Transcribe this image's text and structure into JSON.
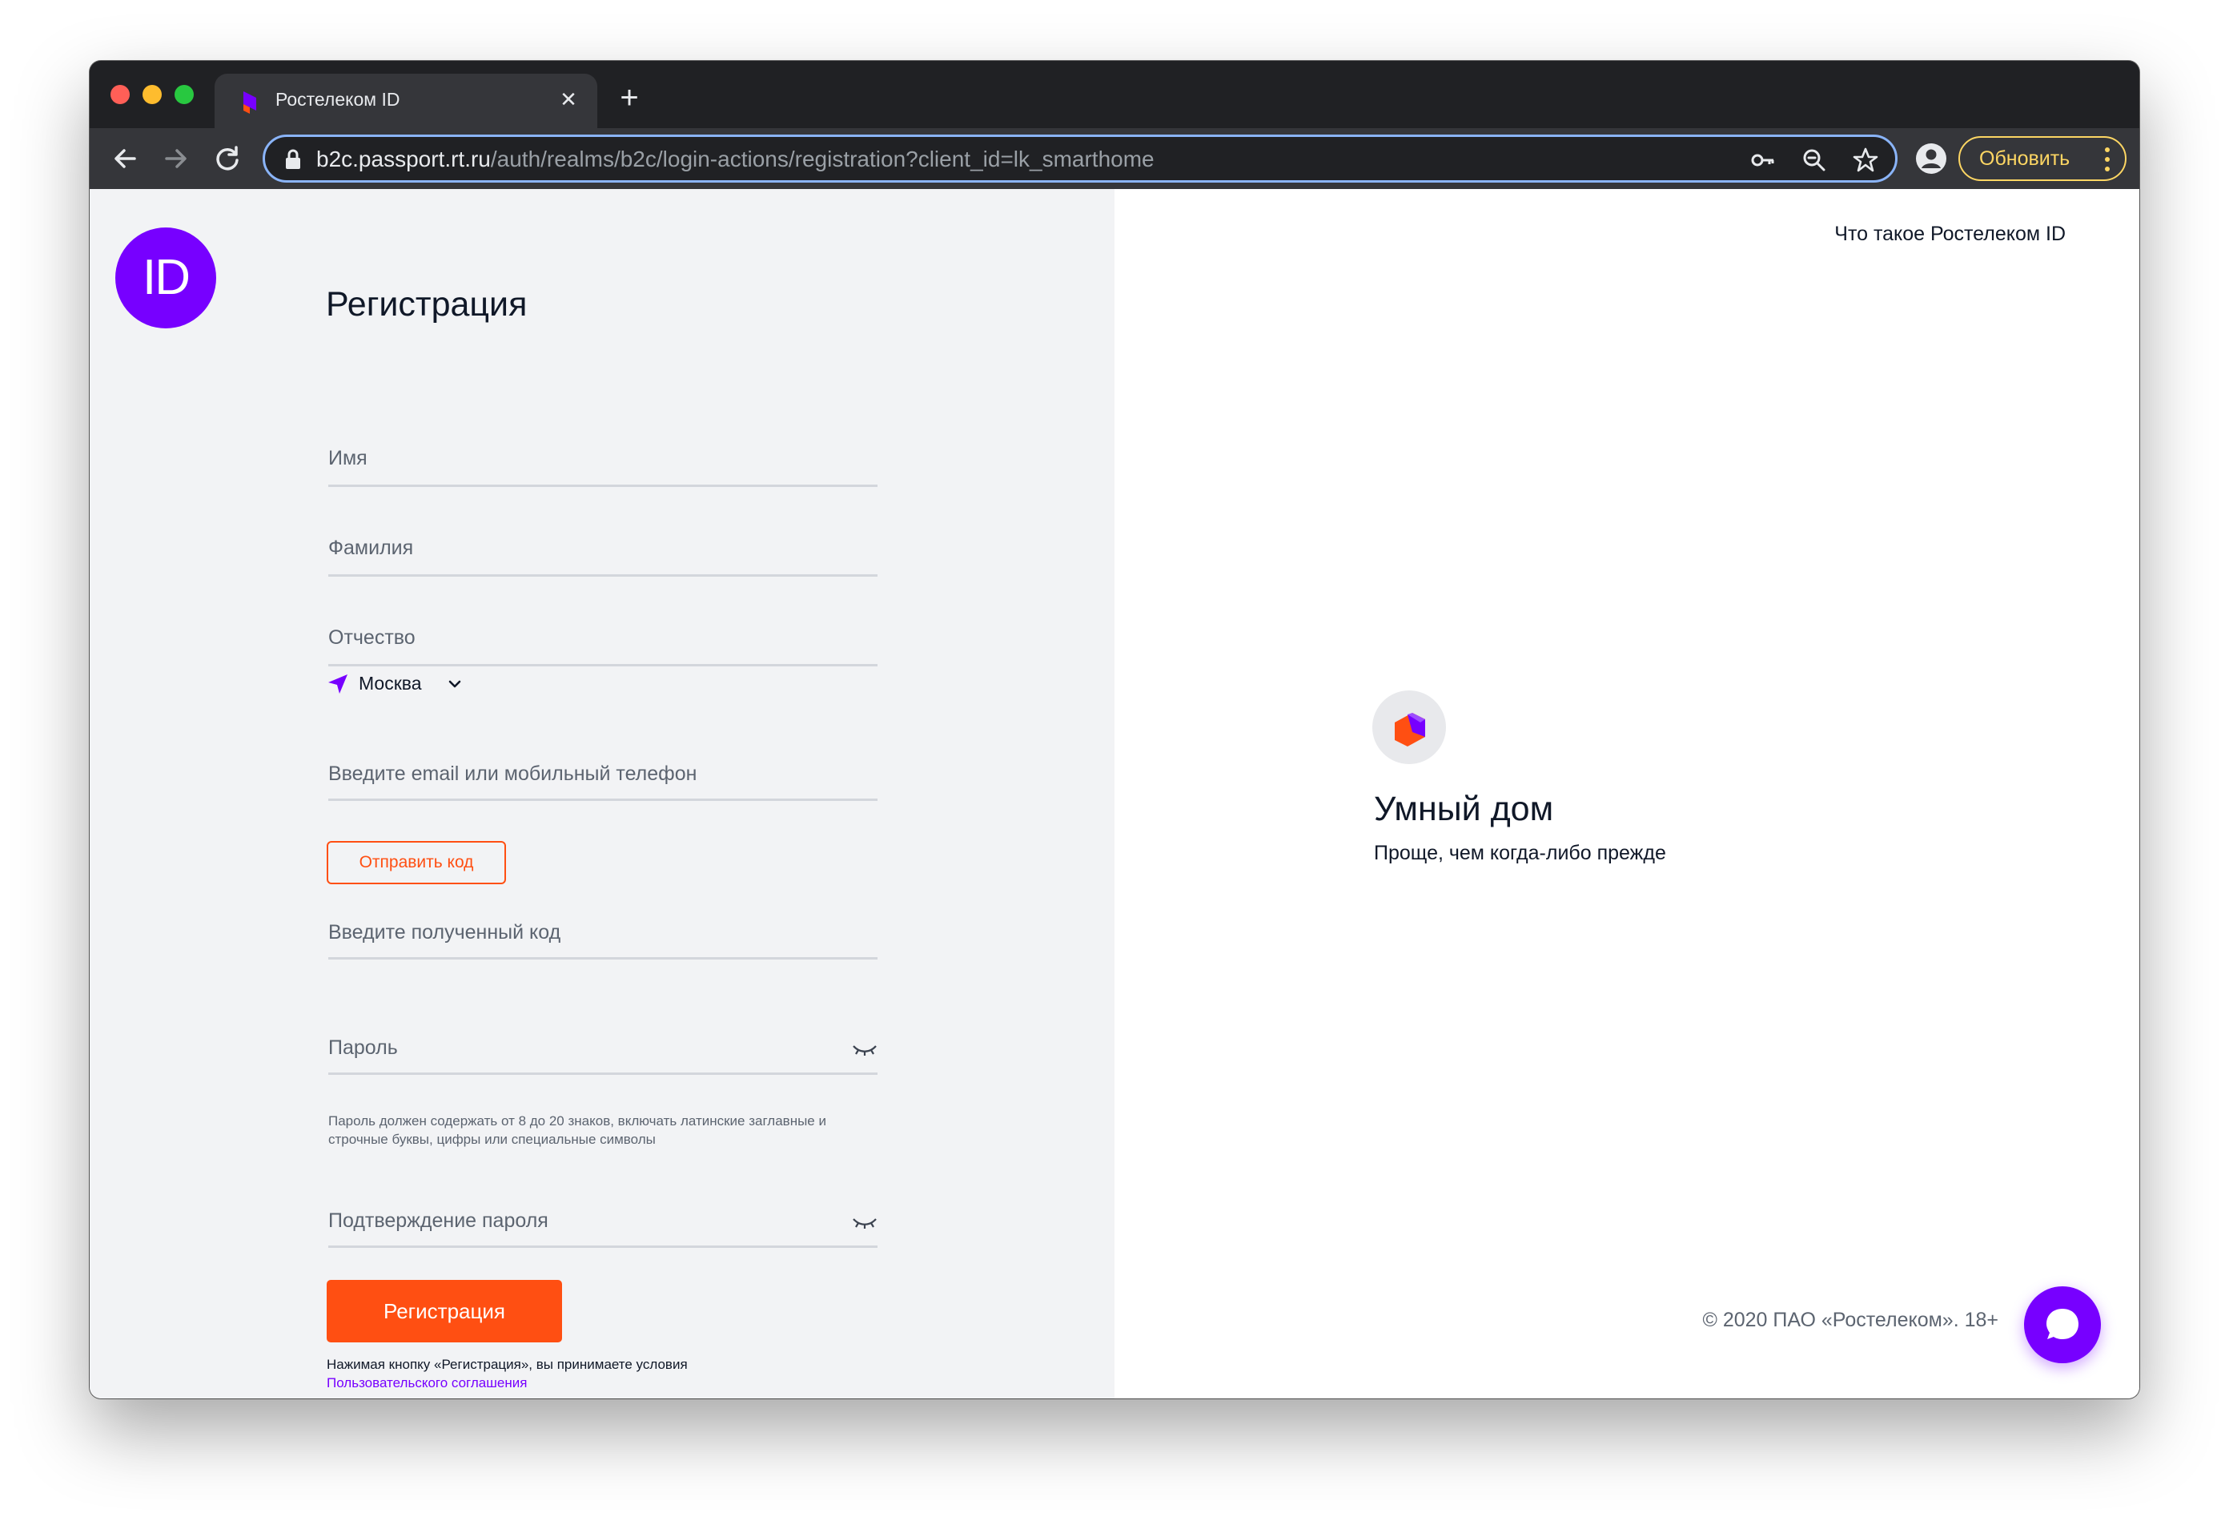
{
  "browser": {
    "tab": {
      "title": "Ростелеком ID",
      "close_icon": "close-icon",
      "favicon": "rostelecom-favicon"
    },
    "new_tab_icon": "plus-icon",
    "nav": {
      "back_icon": "arrow-left-icon",
      "forward_icon": "arrow-right-icon",
      "reload_icon": "reload-icon"
    },
    "address_bar": {
      "host": "b2c.passport.rt.ru",
      "path": "/auth/realms/b2c/login-actions/registration?client_id=lk_smarthome",
      "lock_icon": "lock-icon",
      "icons": [
        "key-icon",
        "zoom-icon",
        "star-icon"
      ]
    },
    "profile_icon": "account-circle-icon",
    "update_button": {
      "label": "Обновить",
      "menu_icon": "more-vert-icon"
    }
  },
  "logo": {
    "text": "ID",
    "color": "#7700ff"
  },
  "form": {
    "title": "Регистрация",
    "fields": {
      "first_name": "Имя",
      "last_name": "Фамилия",
      "patronymic": "Отчество",
      "contact": "Введите email или мобильный телефон",
      "code": "Введите полученный код",
      "password": "Пароль",
      "password_confirm": "Подтверждение пароля"
    },
    "region": {
      "value": "Москва",
      "icon": "location-arrow-icon",
      "chevron": "chevron-down-icon"
    },
    "send_code_label": "Отправить код",
    "password_hint": "Пароль должен содержать от 8 до 20 знаков, включать латинские заглавные и строчные буквы, цифры или специальные символы",
    "submit_label": "Регистрация",
    "agreement_text": "Нажимая кнопку «Регистрация», вы принимаете условия",
    "agreement_link": "Пользовательского соглашения",
    "eye_icon": "eye-closed-icon"
  },
  "promo": {
    "what_is_link": "Что такое Ростелеком ID",
    "product_title": "Умный дом",
    "product_subtitle": "Проще, чем когда-либо прежде",
    "product_icon": "smart-home-icon"
  },
  "footer": {
    "copyright": "© 2020 ПАО «Ростелеком». 18+"
  },
  "chat_button_icon": "chat-bubble-icon",
  "colors": {
    "accent_purple": "#7700ff",
    "accent_orange": "#ff4f12",
    "update_yellow": "#fdd663"
  }
}
